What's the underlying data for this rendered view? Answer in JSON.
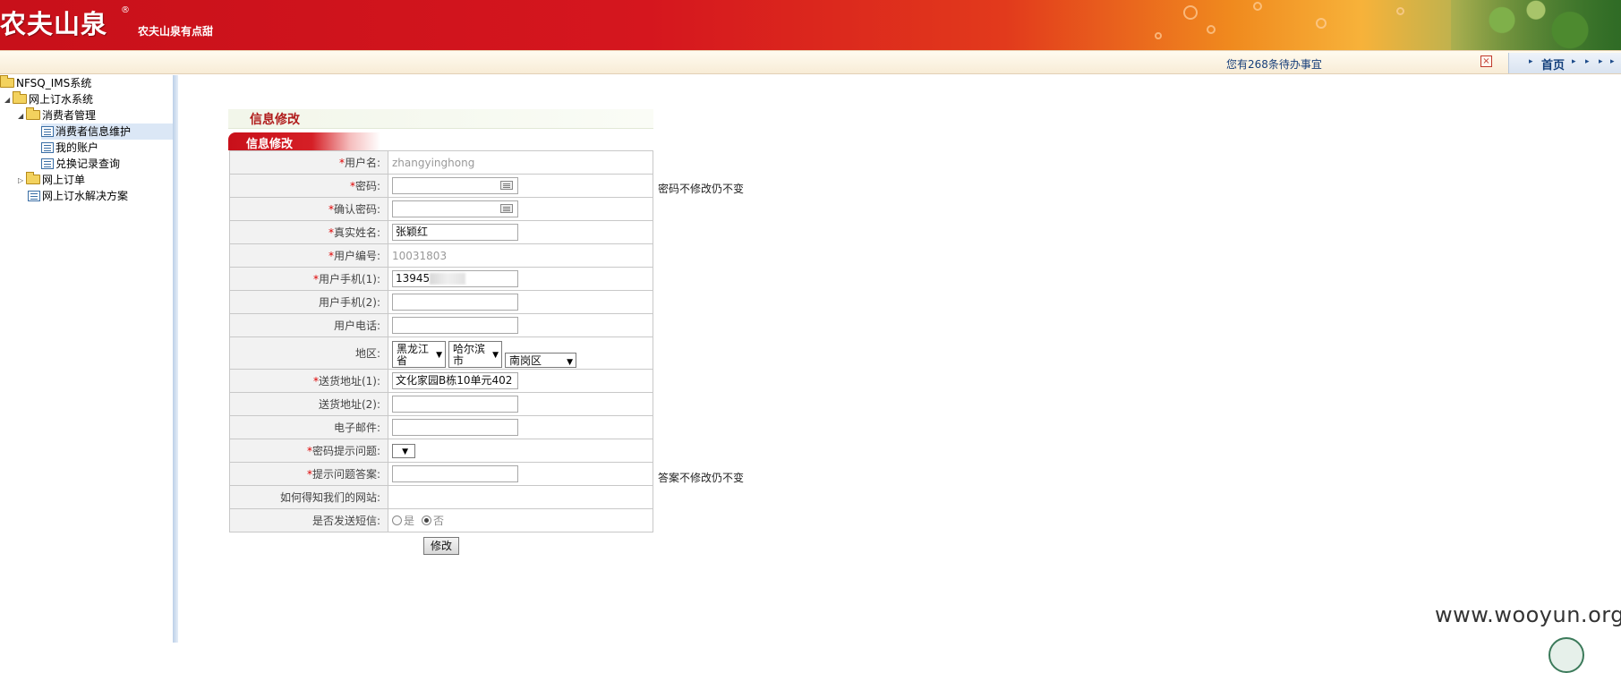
{
  "header": {
    "logo_text": "农夫山泉",
    "registered_mark": "®",
    "slogan": "农夫山泉有点甜"
  },
  "notice_bar": {
    "todo_text": "您有268条待办事宜",
    "close_symbol": "×",
    "nav_home": "首页"
  },
  "sidebar": {
    "tree": [
      {
        "label": "NFSQ_IMS系统",
        "type": "folder",
        "level": 0
      },
      {
        "label": "网上订水系统",
        "type": "folder",
        "level": 1,
        "expanded": true
      },
      {
        "label": "消费者管理",
        "type": "folder",
        "level": 2,
        "expanded": true
      },
      {
        "label": "消费者信息维护",
        "type": "page",
        "level": 3,
        "selected": true
      },
      {
        "label": "我的账户",
        "type": "page",
        "level": 3
      },
      {
        "label": "兑换记录查询",
        "type": "page",
        "level": 3
      },
      {
        "label": "网上订单",
        "type": "folder",
        "level": 2,
        "expanded": false
      },
      {
        "label": "网上订水解决方案",
        "type": "page",
        "level": 2
      }
    ]
  },
  "main": {
    "panel_title": "信息修改",
    "tab_title": "信息修改",
    "required_mark": "*",
    "fields": {
      "username": {
        "label": "用户名:",
        "value": "zhangyinghong"
      },
      "password": {
        "label": "密码:",
        "value": "",
        "note": "密码不修改仍不变"
      },
      "confirm_password": {
        "label": "确认密码:",
        "value": ""
      },
      "real_name": {
        "label": "真实姓名:",
        "value": "张颖红"
      },
      "user_id": {
        "label": "用户编号:",
        "value": "10031803"
      },
      "mobile1": {
        "label": "用户手机(1):",
        "value": "13945"
      },
      "mobile2": {
        "label": "用户手机(2):",
        "value": ""
      },
      "phone": {
        "label": "用户电话:",
        "value": ""
      },
      "region": {
        "label": "地区:",
        "province": "黑龙江省",
        "city": "哈尔滨市",
        "district": "南岗区"
      },
      "address1": {
        "label": "送货地址(1):",
        "value": "文化家园B栋10单元402"
      },
      "address2": {
        "label": "送货地址(2):",
        "value": ""
      },
      "email": {
        "label": "电子邮件:",
        "value": ""
      },
      "security_question": {
        "label": "密码提示问题:",
        "value": ""
      },
      "security_answer": {
        "label": "提示问题答案:",
        "value": "",
        "note": "答案不修改仍不变"
      },
      "how_known": {
        "label": "如何得知我们的网站:",
        "value": ""
      },
      "send_sms": {
        "label": "是否发送短信:",
        "option_yes": "是",
        "option_no": "否",
        "selected": "否"
      }
    },
    "submit_label": "修改"
  },
  "watermark": "www.wooyun.org"
}
